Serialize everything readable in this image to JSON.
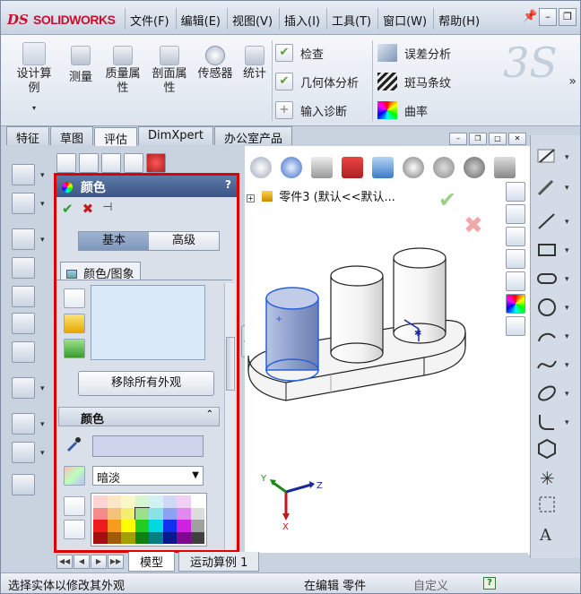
{
  "app": {
    "logo_text": "SOLIDWORKS",
    "logo_mark": "DS"
  },
  "menu": {
    "items": [
      "文件(F)",
      "编辑(E)",
      "视图(V)",
      "插入(I)",
      "工具(T)",
      "窗口(W)",
      "帮助(H)"
    ]
  },
  "ribbon": {
    "design_study": "设计算例",
    "measure": "测量",
    "mass_props": "质量属性",
    "section_props": "剖面属性",
    "sensor": "传感器",
    "statistics": "统计",
    "check": "检查",
    "geometry_analysis": "几何体分析",
    "import_diagnostics": "输入诊断",
    "deviation_analysis": "误差分析",
    "zebra_stripes": "斑马条纹",
    "curvature": "曲率",
    "more": "»"
  },
  "command_tabs": [
    "特征",
    "草图",
    "评估",
    "DimXpert",
    "办公室产品"
  ],
  "active_command_tab": "评估",
  "property_manager": {
    "title": "颜色",
    "help": "?",
    "ok_icon": "check-icon",
    "cancel_icon": "x-icon",
    "pin_icon": "pushpin-icon",
    "mode_basic": "基本",
    "mode_advanced": "高级",
    "tab_label": "颜色/图象",
    "remove_all": "移除所有外观",
    "color_section": "颜色",
    "dropdown_value": "暗淡",
    "swatch_color": "#cdd4ec"
  },
  "viewport": {
    "tree_label": "零件3 (默认<<默认...",
    "triad_x": "X",
    "triad_y": "Y",
    "triad_z": "Z"
  },
  "bottom_tabs": [
    "模型",
    "运动算例 1"
  ],
  "status": {
    "left": "选择实体以修改其外观",
    "mid": "在编辑 零件",
    "right": "自定义",
    "help": "?"
  },
  "colors": {
    "highlight_border": "#e00000",
    "header_blue": "#3b5584",
    "selected_cylinder": "#9fb0d6",
    "accent_green": "#2c9a2c",
    "accent_red": "#c81818"
  }
}
